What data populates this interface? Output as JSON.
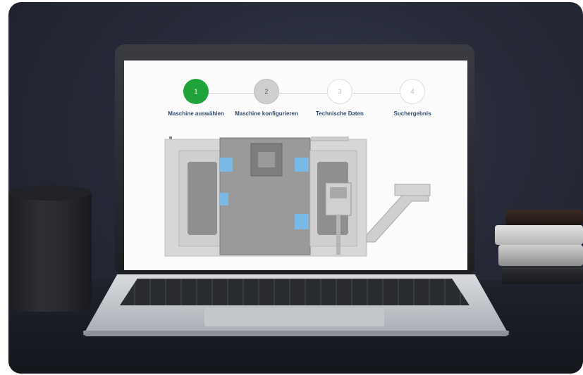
{
  "wizard": {
    "steps": [
      {
        "number": "1",
        "label": "Maschine auswählen",
        "state": "active"
      },
      {
        "number": "2",
        "label": "Maschine konfigurieren",
        "state": "next"
      },
      {
        "number": "3",
        "label": "Technische Daten",
        "state": "pending"
      },
      {
        "number": "4",
        "label": "Suchergebnis",
        "state": "pending"
      }
    ]
  },
  "colors": {
    "active": "#1fa33a",
    "next": "#cfcfcf",
    "pending": "#ffffff",
    "label_text": "#2e4a6b",
    "component_blue": "#7ab8e6"
  },
  "illustration": {
    "subject": "cnc-lathe-machine"
  }
}
